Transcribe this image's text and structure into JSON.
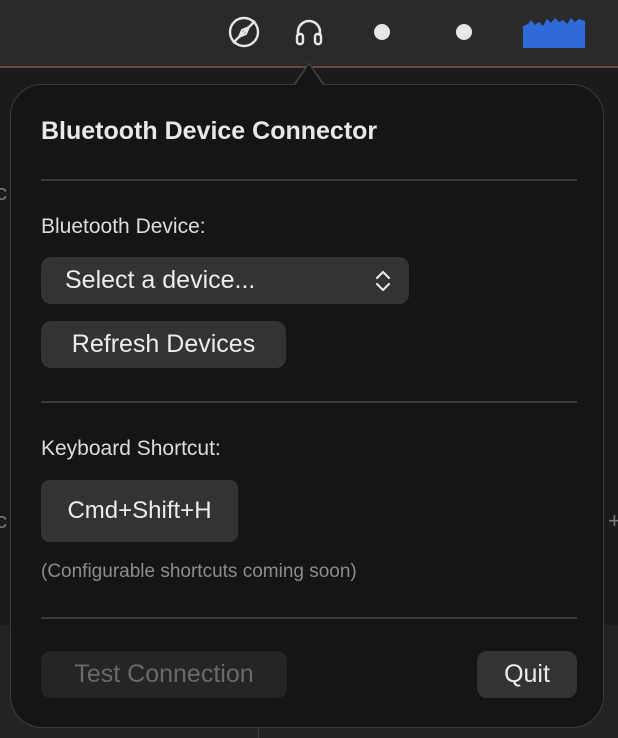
{
  "menubar": {
    "items": [
      {
        "icon": "compass-slash-icon"
      },
      {
        "icon": "headphones-icon"
      },
      {
        "icon": "dot-icon"
      },
      {
        "icon": "dot-icon"
      },
      {
        "icon": "activity-graph-icon"
      }
    ],
    "graph_color": "#2f6bd8"
  },
  "popover": {
    "title": "Bluetooth Device Connector",
    "device_section": {
      "label": "Bluetooth Device:",
      "select_value": "Select a device...",
      "refresh_label": "Refresh Devices"
    },
    "shortcut_section": {
      "label": "Keyboard Shortcut:",
      "shortcut": "Cmd+Shift+H",
      "hint": "(Configurable shortcuts coming soon)"
    },
    "footer": {
      "test_label": "Test Connection",
      "quit_label": "Quit"
    }
  }
}
